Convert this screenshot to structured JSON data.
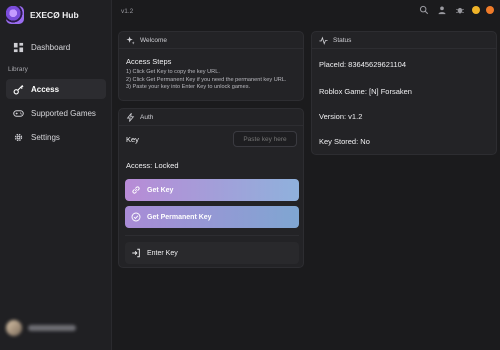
{
  "app": {
    "title": "EXECØ Hub",
    "version": "v1.2"
  },
  "sidebar": {
    "section_label": "Library",
    "items": [
      {
        "label": "Dashboard",
        "icon": "dashboard-icon"
      },
      {
        "label": "Access",
        "icon": "key-icon"
      },
      {
        "label": "Supported Games",
        "icon": "gamepad-icon"
      },
      {
        "label": "Settings",
        "icon": "gear-icon"
      }
    ]
  },
  "colors": {
    "background": "#1b1b1d",
    "accent_gradient_start": "#b88bd6",
    "accent_gradient_end": "#8fb1dc",
    "dot_yellow": "#f0b429",
    "dot_orange": "#f07b29"
  },
  "welcome": {
    "header": "Welcome",
    "title": "Access Steps",
    "steps": [
      "1) Click Get Key to copy the key URL.",
      "2) Click Get Permanent Key if you need the permanent key URL.",
      "3) Paste your key into Enter Key to unlock games."
    ]
  },
  "auth": {
    "header": "Auth",
    "key_label": "Key",
    "key_placeholder": "Paste key here",
    "access_status": "Access: Locked",
    "get_key_label": "Get Key",
    "get_permanent_key_label": "Get Permanent Key",
    "enter_key_label": "Enter Key"
  },
  "status": {
    "header": "Status",
    "place_id": "PlaceId: 83645629621104",
    "game": "Roblox Game: [N] Forsaken",
    "version": "Version: v1.2",
    "key_stored": "Key Stored: No"
  }
}
